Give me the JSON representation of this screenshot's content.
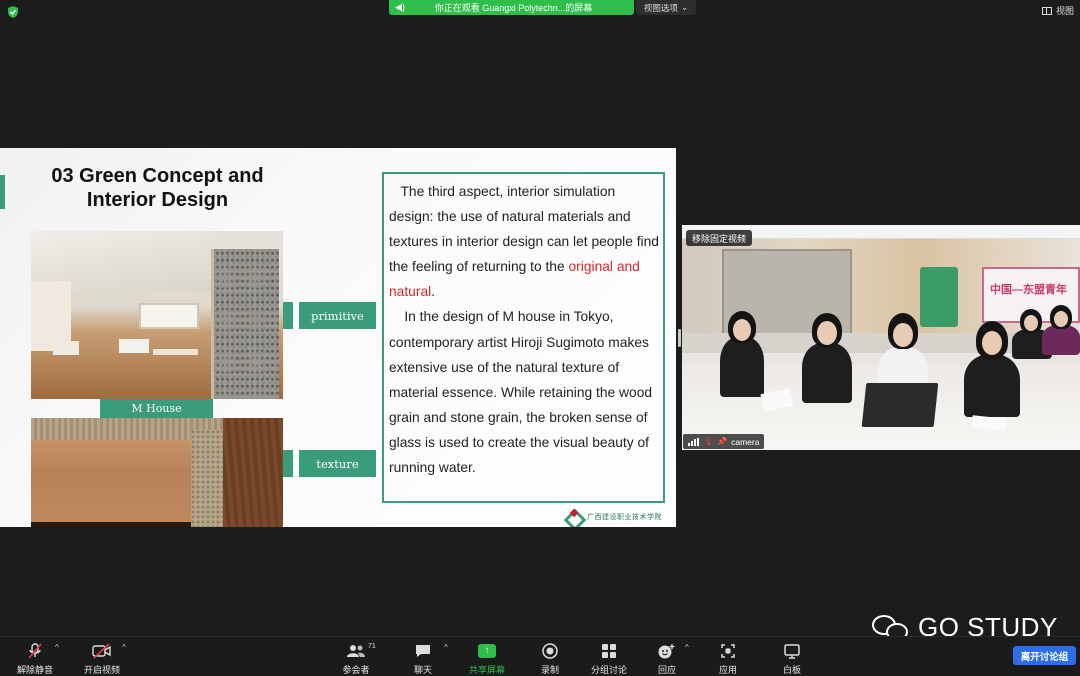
{
  "top": {
    "share_banner": "你正在观看 Guangxi Polytechn...的屏幕",
    "view_options": "视图选项",
    "view_button": "视图"
  },
  "slide": {
    "title_line1": "03 Green Concept and",
    "title_line2": "Interior Design",
    "caption_photo1": "M House",
    "tag_primitive": "primitive",
    "tag_texture": "texture",
    "paragraph1_before": "The third aspect, interior simulation design: the use of natural materials and textures in interior design can let people find the feeling of returning to the",
    "paragraph1_red": "original and natural",
    "paragraph1_after": ".",
    "paragraph2": "In the design of M house in Tokyo, contemporary artist Hiroji Sugimoto makes extensive use of the natural texture of material essence.  While retaining the wood grain and stone grain, the broken sense of glass is used to create the visual beauty of running water.",
    "logo_text": "广西建设职业技术学院",
    "colors": {
      "accent": "#3a9c7a",
      "highlight": "#d0282c"
    }
  },
  "video": {
    "pin_label": "移除固定视频",
    "camera_name": "camera",
    "banner_text": "中国—东盟青年"
  },
  "watermark": "GO STUDY",
  "toolbar": {
    "unmute": "解除静音",
    "start_video": "开启视频",
    "participants": "参会者",
    "participants_count": "71",
    "chat": "聊天",
    "share_screen": "共享屏幕",
    "record": "录制",
    "breakout": "分组讨论",
    "reactions": "回应",
    "apps": "应用",
    "whiteboard": "白板",
    "leave": "离开讨论组"
  }
}
